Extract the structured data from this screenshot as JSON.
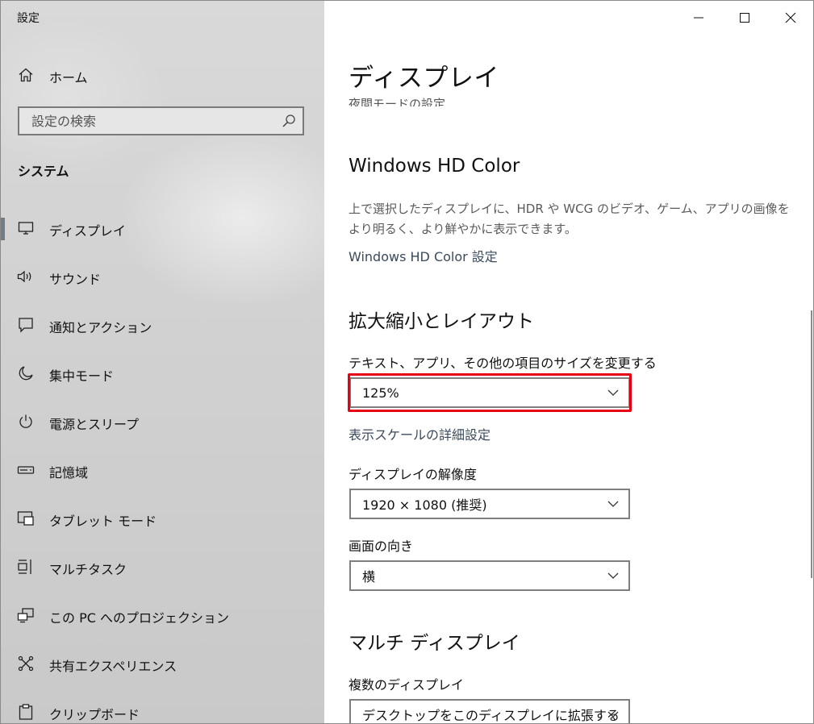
{
  "window": {
    "app_title": "設定"
  },
  "sidebar": {
    "home_label": "ホーム",
    "search_placeholder": "設定の検索",
    "section_title": "システム",
    "items": [
      {
        "label": "ディスプレイ",
        "icon": "monitor-icon",
        "selected": true
      },
      {
        "label": "サウンド",
        "icon": "speaker-icon"
      },
      {
        "label": "通知とアクション",
        "icon": "notification-icon"
      },
      {
        "label": "集中モード",
        "icon": "moon-icon"
      },
      {
        "label": "電源とスリープ",
        "icon": "power-icon"
      },
      {
        "label": "記憶域",
        "icon": "storage-icon"
      },
      {
        "label": "タブレット モード",
        "icon": "tablet-icon"
      },
      {
        "label": "マルチタスク",
        "icon": "multitask-icon"
      },
      {
        "label": "この PC へのプロジェクション",
        "icon": "projection-icon"
      },
      {
        "label": "共有エクスペリエンス",
        "icon": "share-icon"
      },
      {
        "label": "クリップボード",
        "icon": "clipboard-icon"
      }
    ]
  },
  "main": {
    "title": "ディスプレイ",
    "cutoff_link": "夜間モードの設定",
    "hd_color": {
      "heading": "Windows HD Color",
      "description": "上で選択したディスプレイに、HDR や WCG のビデオ、ゲーム、アプリの画像をより明るく、より鮮やかに表示できます。",
      "link": "Windows HD Color 設定"
    },
    "scale_layout": {
      "heading": "拡大縮小とレイアウト",
      "scale_label": "テキスト、アプリ、その他の項目のサイズを変更する",
      "scale_value": "125%",
      "advanced_link": "表示スケールの詳細設定",
      "resolution_label": "ディスプレイの解像度",
      "resolution_value": "1920 × 1080 (推奨)",
      "orientation_label": "画面の向き",
      "orientation_value": "横"
    },
    "multi_display": {
      "heading": "マルチ ディスプレイ",
      "label": "複数のディスプレイ",
      "value": "デスクトップをこのディスプレイに拡張する"
    }
  },
  "colors": {
    "highlight": "#e60012",
    "selection_bar": "#737b86"
  }
}
